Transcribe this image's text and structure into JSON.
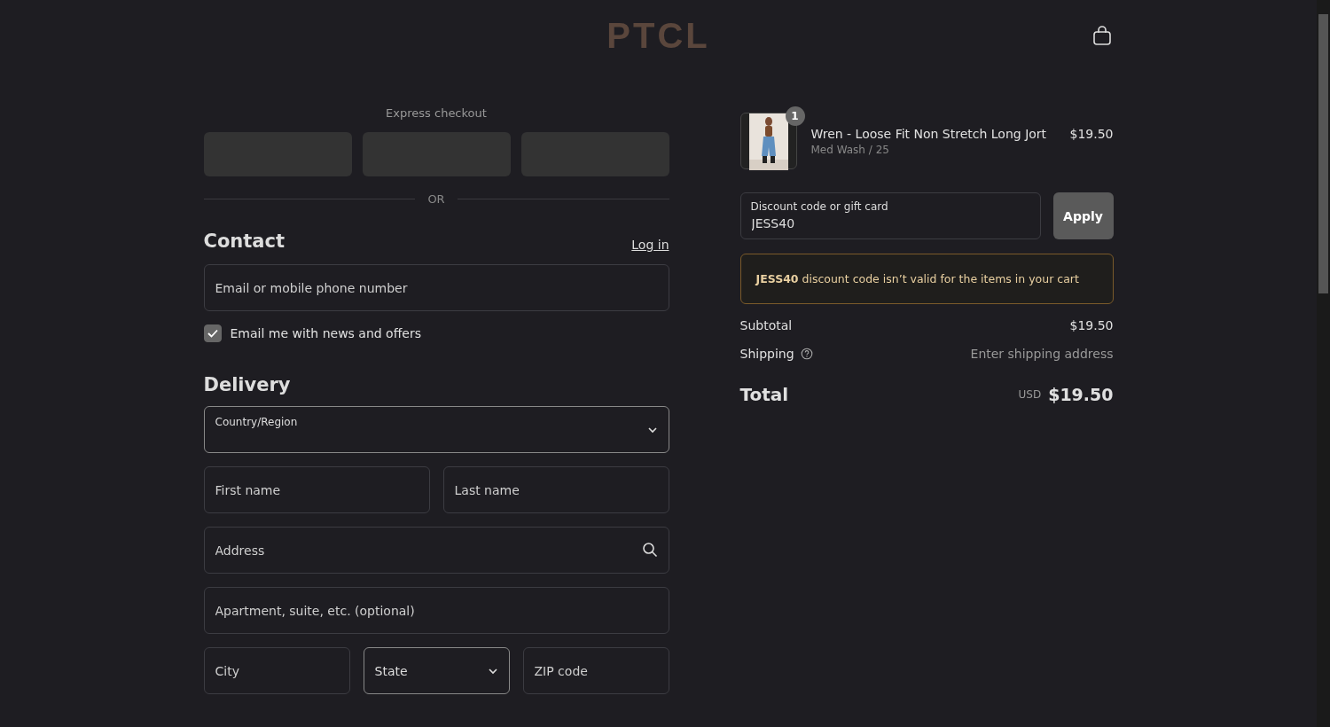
{
  "header": {
    "logo": "PTCL"
  },
  "express_checkout": {
    "title": "Express checkout",
    "buttons": [
      {
        "kind": "payment"
      },
      {
        "kind": "payment"
      },
      {
        "kind": "payment"
      }
    ],
    "divider": "OR"
  },
  "contact": {
    "heading": "Contact",
    "login_link": "Log in",
    "email": {
      "placeholder": "Email or mobile phone number"
    },
    "newsletter": {
      "label": "Email me with news and offers",
      "checked": true
    }
  },
  "delivery": {
    "heading": "Delivery",
    "rows": [
      [
        {
          "kind": "select",
          "label": "Country/Region"
        }
      ],
      [
        {
          "kind": "text",
          "placeholder": "First name"
        },
        {
          "kind": "text",
          "placeholder": "Last name"
        }
      ],
      [
        {
          "kind": "search",
          "placeholder": "Address"
        }
      ],
      [
        {
          "kind": "text",
          "placeholder": "Apartment, suite, etc. (optional)"
        }
      ],
      [
        {
          "kind": "text",
          "placeholder": "City"
        },
        {
          "kind": "select",
          "placeholder": "State"
        },
        {
          "kind": "text",
          "placeholder": "ZIP code"
        }
      ]
    ]
  },
  "order": {
    "items": [
      {
        "quantity": "1",
        "name": "Wren - Loose Fit Non Stretch Long Jort",
        "variant": "Med Wash / 25",
        "price": "$19.50"
      }
    ],
    "discount": {
      "label": "Discount code or gift card",
      "value": "JESS40",
      "button": "Apply"
    },
    "error": "**JESS40** discount code isn’t valid for the items in your cart",
    "subtotal": {
      "label": "Subtotal",
      "value": "$19.50"
    },
    "shipping": {
      "label": "Shipping",
      "value": "Enter shipping address"
    },
    "total": {
      "label": "Total",
      "currency": "USD",
      "value": "$19.50"
    }
  }
}
